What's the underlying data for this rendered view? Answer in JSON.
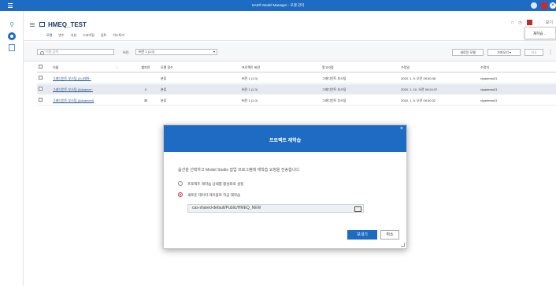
{
  "titlebar": {
    "title": "SAS® Model Manager - 모델 관리",
    "close_glyph": "✕"
  },
  "project": {
    "title": "HMEQ_TEST",
    "tabs": [
      "모델",
      "변수",
      "속성",
      "스코어링",
      "검토",
      "히스토리"
    ],
    "header_tools": [
      "□",
      "◷",
      "⋮",
      "보기"
    ],
    "menu_item": "재학습..."
  },
  "toolbar": {
    "search_placeholder": "이름 검색",
    "version_label": "버전:",
    "version_value": "버전 1 (1.0)",
    "btn_new_model": "새로운 모델",
    "btn_import": "가져오기 ▾",
    "btn_disabled": "비교"
  },
  "table": {
    "headers": {
      "name": "이름",
      "sort": "↑",
      "champion": "챔피언",
      "function": "모델 함수",
      "version": "프로젝트 버전",
      "algorithm": "알고리즘",
      "modified": "수정일",
      "modifier": "수정자"
    },
    "rows": [
      {
        "name": "그래디언트 부스팅 (2) (테마~",
        "champion": "",
        "function": "분류",
        "version": "버전 1 (1.0)",
        "algorithm": "그래디언트 부스팅",
        "modified": "2020. 1. 9. 오전 09:30:36",
        "modifier": "viyademo01"
      },
      {
        "name": "그래디언트 부스팅 (Advance~",
        "champion": "X",
        "function": "분류",
        "version": "버전 1 (1.0)",
        "algorithm": "그래디언트 부스팅",
        "modified": "2020. 1. 10. 오전 09:24:37",
        "modifier": "viyademo01"
      },
      {
        "name": "그래디언트 부스팅 (Advanced)",
        "champion": "⊠",
        "function": "분류",
        "version": "버전 1 (1.0)",
        "algorithm": "그래디언트 부스팅",
        "modified": "2020. 1. 9. 오전 09:30:32",
        "modifier": "viyademo01"
      }
    ]
  },
  "dialog": {
    "title": "프로젝트 재학습",
    "close_glyph": "×",
    "description": "옵션을 선택하고 Model Studio 잡업 프로그램에 재학습 요청을 전송합니다.",
    "option1": "프로젝트 재학습 상태를 활성화로 설정",
    "option2": "새로운 데이터 테이블로 지금 재학습",
    "path": "cas-shared-default/Public/HMEQ_NEW",
    "ok": "보내기",
    "cancel": "취소"
  }
}
